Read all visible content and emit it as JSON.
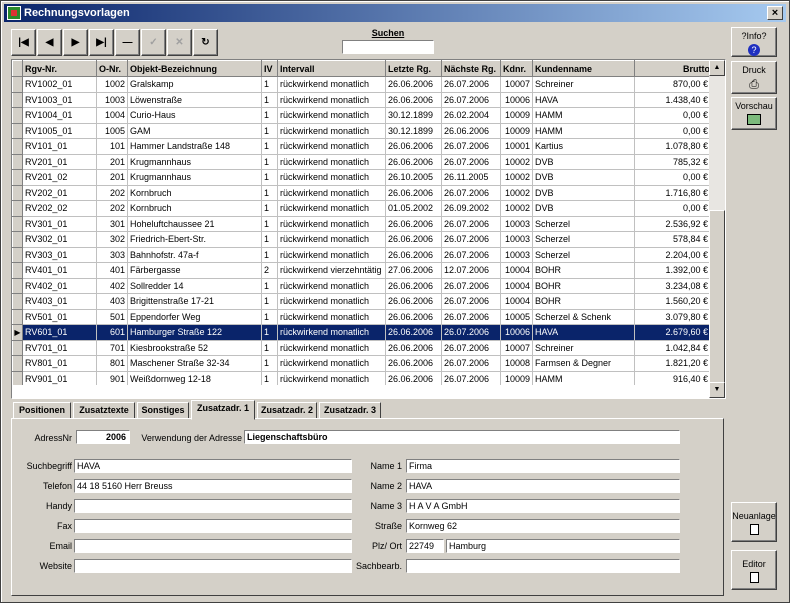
{
  "window": {
    "title": "Rechnungsvorlagen",
    "close_label": "×"
  },
  "toolbar": {
    "first": "|◀",
    "prev": "◀",
    "next": "▶",
    "last": "▶|",
    "delete": "—",
    "confirm": "✓",
    "cancel": "✕",
    "refresh": "↻"
  },
  "search": {
    "label": "Suchen",
    "value": ""
  },
  "side": {
    "info": "?Info?",
    "druck": "Druck",
    "vorschau": "Vorschau",
    "neuanlage": "Neuanlage",
    "editor": "Editor"
  },
  "grid": {
    "columns": [
      "Rgv-Nr.",
      "O-Nr.",
      "Objekt-Bezeichnung",
      "IV",
      "Intervall",
      "Letzte Rg.",
      "Nächste Rg.",
      "Kdnr.",
      "Kundenname",
      "Brutto"
    ],
    "rows": [
      [
        "RV1002_01",
        "1002",
        "Gralskamp",
        "1",
        "rückwirkend monatlich",
        "26.06.2006",
        "26.07.2006",
        "10007",
        "Schreiner",
        "870,00 €"
      ],
      [
        "RV1003_01",
        "1003",
        "Löwenstraße",
        "1",
        "rückwirkend monatlich",
        "26.06.2006",
        "26.07.2006",
        "10006",
        "HAVA",
        "1.438,40 €"
      ],
      [
        "RV1004_01",
        "1004",
        "Curio-Haus",
        "1",
        "rückwirkend monatlich",
        "30.12.1899",
        "26.02.2004",
        "10009",
        "HAMM",
        "0,00 €"
      ],
      [
        "RV1005_01",
        "1005",
        "GAM",
        "1",
        "rückwirkend monatlich",
        "30.12.1899",
        "26.06.2006",
        "10009",
        "HAMM",
        "0,00 €"
      ],
      [
        "RV101_01",
        "101",
        "Hammer Landstraße 148",
        "1",
        "rückwirkend monatlich",
        "26.06.2006",
        "26.07.2006",
        "10001",
        "Kartius",
        "1.078,80 €"
      ],
      [
        "RV201_01",
        "201",
        "Krugmannhaus",
        "1",
        "rückwirkend monatlich",
        "26.06.2006",
        "26.07.2006",
        "10002",
        "DVB",
        "785,32 €"
      ],
      [
        "RV201_02",
        "201",
        "Krugmannhaus",
        "1",
        "rückwirkend monatlich",
        "26.10.2005",
        "26.11.2005",
        "10002",
        "DVB",
        "0,00 €"
      ],
      [
        "RV202_01",
        "202",
        "Kornbruch",
        "1",
        "rückwirkend monatlich",
        "26.06.2006",
        "26.07.2006",
        "10002",
        "DVB",
        "1.716,80 €"
      ],
      [
        "RV202_02",
        "202",
        "Kornbruch",
        "1",
        "rückwirkend monatlich",
        "01.05.2002",
        "26.09.2002",
        "10002",
        "DVB",
        "0,00 €"
      ],
      [
        "RV301_01",
        "301",
        "Hoheluftchaussee 21",
        "1",
        "rückwirkend monatlich",
        "26.06.2006",
        "26.07.2006",
        "10003",
        "Scherzel",
        "2.536,92 €"
      ],
      [
        "RV302_01",
        "302",
        "Friedrich-Ebert-Str.",
        "1",
        "rückwirkend monatlich",
        "26.06.2006",
        "26.07.2006",
        "10003",
        "Scherzel",
        "578,84 €"
      ],
      [
        "RV303_01",
        "303",
        "Bahnhofstr. 47a-f",
        "1",
        "rückwirkend monatlich",
        "26.06.2006",
        "26.07.2006",
        "10003",
        "Scherzel",
        "2.204,00 €"
      ],
      [
        "RV401_01",
        "401",
        "Färbergasse",
        "2",
        "rückwirkend vierzehntätig",
        "27.06.2006",
        "12.07.2006",
        "10004",
        "BOHR",
        "1.392,00 €"
      ],
      [
        "RV402_01",
        "402",
        "Sollredder 14",
        "1",
        "rückwirkend monatlich",
        "26.06.2006",
        "26.07.2006",
        "10004",
        "BOHR",
        "3.234,08 €"
      ],
      [
        "RV403_01",
        "403",
        "Brigittenstraße 17-21",
        "1",
        "rückwirkend monatlich",
        "26.06.2006",
        "26.07.2006",
        "10004",
        "BOHR",
        "1.560,20 €"
      ],
      [
        "RV501_01",
        "501",
        "Eppendorfer Weg",
        "1",
        "rückwirkend monatlich",
        "26.06.2006",
        "26.07.2006",
        "10005",
        "Scherzel & Schenk",
        "3.079,80 €"
      ],
      [
        "RV601_01",
        "601",
        "Hamburger Straße 122",
        "1",
        "rückwirkend monatlich",
        "26.06.2006",
        "26.07.2006",
        "10006",
        "HAVA",
        "2.679,60 €"
      ],
      [
        "RV701_01",
        "701",
        "Kiesbrookstraße 52",
        "1",
        "rückwirkend monatlich",
        "26.06.2006",
        "26.07.2006",
        "10007",
        "Schreiner",
        "1.042,84 €"
      ],
      [
        "RV801_01",
        "801",
        "Maschener Straße 32-34",
        "1",
        "rückwirkend monatlich",
        "26.06.2006",
        "26.07.2006",
        "10008",
        "Farmsen & Degner",
        "1.821,20 €"
      ],
      [
        "RV901_01",
        "901",
        "Weißdornweg 12-18",
        "1",
        "rückwirkend monatlich",
        "26.06.2006",
        "26.07.2006",
        "10009",
        "HAMM",
        "916,40 €"
      ]
    ],
    "selected_index": 16
  },
  "tabs": [
    "Positionen",
    "Zusatztexte",
    "Sonstiges",
    "Zusatzadr. 1",
    "Zusatzadr. 2",
    "Zusatzadr. 3"
  ],
  "active_tab": "Zusatzadr. 1",
  "form": {
    "adressnr_label": "AdressNr",
    "adressnr": "2006",
    "verwendung_label": "Verwendung der Adresse",
    "verwendung": "Liegenschaftsbüro",
    "suchbegriff_label": "Suchbegriff",
    "suchbegriff": "HAVA",
    "telefon_label": "Telefon",
    "telefon": "44 18 5160 Herr Breuss",
    "handy_label": "Handy",
    "handy": "",
    "fax_label": "Fax",
    "fax": "",
    "email_label": "Email",
    "email": "",
    "website_label": "Website",
    "website": "",
    "name1_label": "Name 1",
    "name1": "Firma",
    "name2_label": "Name 2",
    "name2": "HAVA",
    "name3_label": "Name 3",
    "name3": "H A V A GmbH",
    "strasse_label": "Straße",
    "strasse": "Kornweg 62",
    "plz_label": "Plz/ Ort",
    "plz": "22749",
    "ort": "Hamburg",
    "sachbearb_label": "Sachbearb.",
    "sachbearb": ""
  }
}
